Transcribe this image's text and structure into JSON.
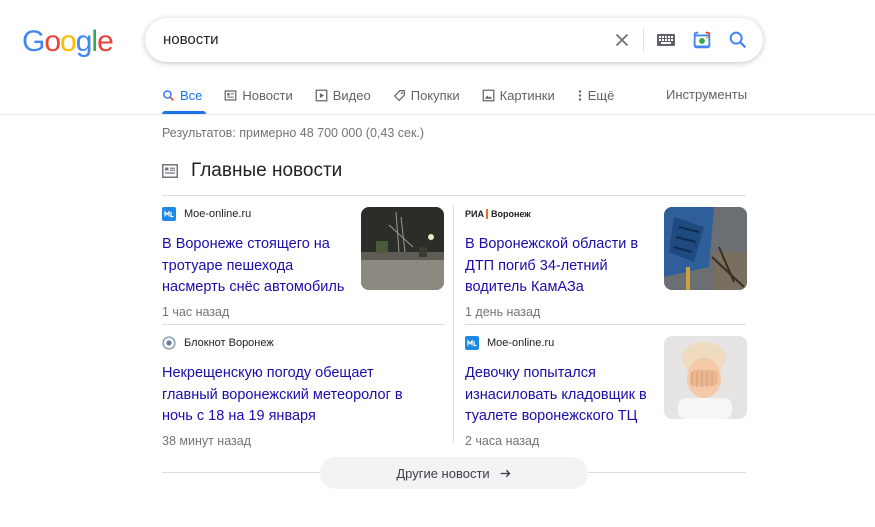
{
  "logo": {
    "letters": [
      "G",
      "o",
      "o",
      "g",
      "l",
      "e"
    ],
    "colors": [
      "#4285f4",
      "#ea4335",
      "#fbbc05",
      "#4285f4",
      "#34a853",
      "#ea4335"
    ]
  },
  "search": {
    "query": "новости"
  },
  "tabs": [
    {
      "label": "Все",
      "icon": "search-icon",
      "active": true
    },
    {
      "label": "Новости",
      "icon": "news-icon"
    },
    {
      "label": "Видео",
      "icon": "video-icon"
    },
    {
      "label": "Покупки",
      "icon": "tag-icon"
    },
    {
      "label": "Картинки",
      "icon": "image-icon"
    },
    {
      "label": "Ещё",
      "icon": "more-vert-icon"
    }
  ],
  "tools_label": "Инструменты",
  "stats": "Результатов: примерно 48 700 000 (0,43 сек.)",
  "top_stories": {
    "title": "Главные новости",
    "cards": [
      {
        "source": "Moe-online.ru",
        "headline": "В Воронеже стоящего на тротуаре пешехода насмерть снёс автомобиль",
        "time": "1 час назад"
      },
      {
        "source_prefix": "РИА",
        "source": "Воронеж",
        "headline": "В Воронежской области в ДТП погиб 34-летний водитель КамАЗа",
        "time": "1 день назад"
      },
      {
        "source": "Блокнот Воронеж",
        "headline": "Некрещенскую погоду обещает главный воронежский метеоролог в ночь с 18 на 19 января",
        "time": "38 минут назад"
      },
      {
        "source": "Moe-online.ru",
        "headline": "Девочку попытался изнасиловать кладовщик в туалете воронежского ТЦ",
        "time": "2 часа назад"
      }
    ],
    "more_label": "Другие новости"
  },
  "colors": {
    "accent": "#1a73e8",
    "link": "#1a0dab"
  }
}
